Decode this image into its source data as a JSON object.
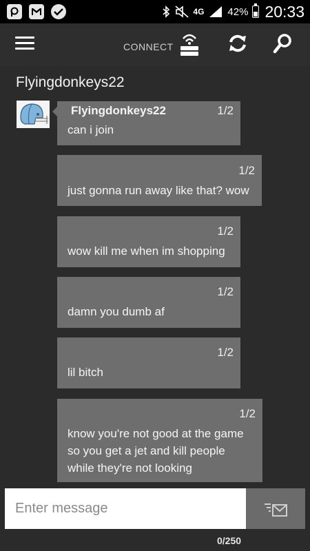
{
  "status_bar": {
    "network": "4G",
    "battery": "42%",
    "time": "20:33",
    "icons": [
      "p-icon",
      "mail-icon",
      "check-icon",
      "bluetooth-icon",
      "mute-icon",
      "signal-icon",
      "battery-icon"
    ]
  },
  "app_bar": {
    "connect_label": "CONNECT",
    "icons": [
      "hamburger-icon",
      "console-connect-icon",
      "refresh-icon",
      "search-icon"
    ]
  },
  "conversation": {
    "title": "Flyingdonkeys22",
    "messages": [
      {
        "sender": "Flyingdonkeys22",
        "count": "1/2",
        "text": "can i join"
      },
      {
        "count": "1/2",
        "text": "just gonna run away like that? wow"
      },
      {
        "count": "1/2",
        "text": "wow kill me when im shopping"
      },
      {
        "count": "1/2",
        "text": "damn you dumb af"
      },
      {
        "count": "1/2",
        "text": "lil bitch"
      },
      {
        "count": "1/2",
        "text": "know you're not good at the game\nso you get a jet and kill people\nwhile they're not looking"
      }
    ]
  },
  "composer": {
    "placeholder": "Enter message",
    "counter": "0/250"
  },
  "colors": {
    "background": "#2b2b2b",
    "bubble": "#6e6e6e",
    "send_button": "#6b6b6b",
    "input": "#ffffff"
  }
}
